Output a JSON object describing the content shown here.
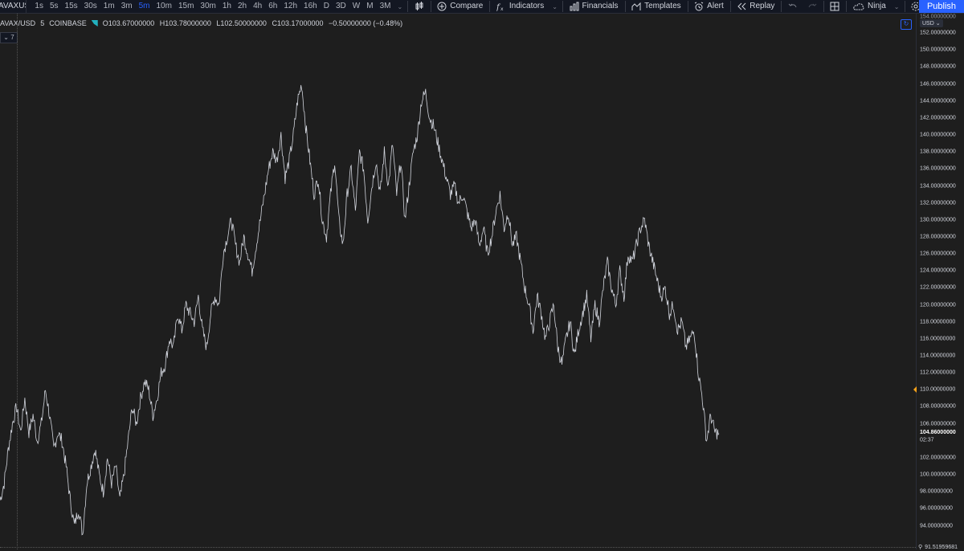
{
  "toolbar": {
    "symbol": "AVAXUSD",
    "intervals": [
      "1s",
      "5s",
      "15s",
      "30s",
      "1m",
      "3m",
      "5m",
      "10m",
      "15m",
      "30m",
      "1h",
      "2h",
      "4h",
      "6h",
      "12h",
      "16h",
      "D",
      "3D",
      "W",
      "M",
      "3M"
    ],
    "active_interval": "5m",
    "compare": "Compare",
    "indicators": "Indicators",
    "financials": "Financials",
    "templates": "Templates",
    "alert": "Alert",
    "replay": "Replay",
    "layout_name": "Ninja",
    "publish": "Publish"
  },
  "legend": {
    "pair": "AVAX/USD",
    "interval": "5",
    "exchange": "COINBASE",
    "open": "O103.67000000",
    "high": "H103.78000000",
    "low": "L102.50000000",
    "close": "C103.17000000",
    "change": "−0.50000000 (−0.48%)",
    "indicator_toggle": "7"
  },
  "price_axis": {
    "currency": "USD",
    "top_partial": "154.00000000",
    "labels": [
      "152.00000000",
      "150.00000000",
      "148.00000000",
      "146.00000000",
      "144.00000000",
      "142.00000000",
      "140.00000000",
      "138.00000000",
      "136.00000000",
      "134.00000000",
      "132.00000000",
      "130.00000000",
      "128.00000000",
      "126.00000000",
      "124.00000000",
      "122.00000000",
      "120.00000000",
      "118.00000000",
      "116.00000000",
      "114.00000000",
      "112.00000000",
      "110.00000000",
      "108.00000000",
      "106.00000000",
      "102.00000000",
      "100.00000000",
      "98.00000000",
      "96.00000000",
      "94.00000000"
    ],
    "current_price": "104.86000000",
    "countdown": "02:37",
    "bottom_label": "91.51959681"
  },
  "chart_data": {
    "type": "line",
    "title": "",
    "xlabel": "",
    "ylabel": "",
    "ylim": [
      91.5,
      154
    ],
    "series": [
      {
        "values": [
          97,
          99,
          103,
          106,
          108,
          105,
          109,
          105,
          107,
          104,
          106,
          110,
          107,
          103,
          105,
          104,
          101,
          97,
          94,
          96,
          93,
          99,
          101,
          103,
          100,
          98,
          102,
          99,
          101,
          97,
          100,
          104,
          108,
          106,
          109,
          111,
          110,
          107,
          109,
          112,
          113,
          116,
          115,
          119,
          117,
          120,
          119,
          118,
          121,
          117,
          115,
          119,
          121,
          120,
          126,
          128,
          130,
          127,
          125,
          128,
          126,
          124,
          127,
          130,
          133,
          136,
          138,
          137,
          140,
          135,
          137,
          140,
          144,
          146,
          141,
          137,
          133,
          135,
          130,
          128,
          133,
          137,
          130,
          127,
          133,
          136,
          131,
          138,
          136,
          130,
          134,
          137,
          133,
          138,
          134,
          139,
          133,
          137,
          130,
          134,
          138,
          140,
          144,
          145,
          142,
          141,
          139,
          137,
          135,
          133,
          134,
          132,
          133,
          131,
          129,
          130,
          127,
          129,
          126,
          128,
          131,
          133,
          129,
          131,
          127,
          128,
          125,
          122,
          120,
          117,
          121,
          119,
          116,
          118,
          120,
          115,
          113,
          116,
          118,
          114,
          117,
          119,
          121,
          116,
          120,
          118,
          122,
          125,
          122,
          120,
          124,
          121,
          126,
          125,
          127,
          129,
          130,
          127,
          125,
          123,
          121,
          122,
          119,
          120,
          117,
          118,
          115,
          116,
          117,
          112,
          109,
          104,
          107,
          105,
          104.86
        ]
      }
    ],
    "grid": false,
    "legend": "none"
  }
}
